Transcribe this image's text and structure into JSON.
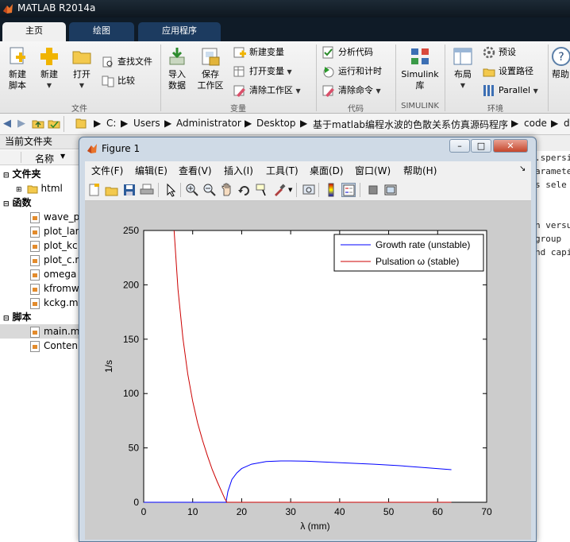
{
  "app": {
    "title": "MATLAB R2014a"
  },
  "tabs": [
    {
      "label": "主页"
    },
    {
      "label": "绘图"
    },
    {
      "label": "应用程序"
    }
  ],
  "ribbon": {
    "new_script": "新建\n脚本",
    "new": "新建",
    "open": "打开",
    "find_files": "查找文件",
    "compare": "比较",
    "import_data": "导入\n数据",
    "save_workspace": "保存\n工作区",
    "new_variable": "新建变量",
    "open_variable": "打开变量",
    "clear_workspace": "清除工作区",
    "analyze_code": "分析代码",
    "run_and_time": "运行和计时",
    "clear_commands": "清除命令",
    "simulink_library": "Simulink\n库",
    "layout": "布局",
    "preferences": "预设",
    "set_path": "设置路径",
    "parallel": "Parallel",
    "help": "帮助",
    "groups": {
      "file": "文件",
      "variable": "变量",
      "code": "代码",
      "simulink": "SIMULINK",
      "environment": "环境"
    }
  },
  "address": {
    "segments": [
      "C:",
      "Users",
      "Administrator",
      "Desktop",
      "基于matlab编程水波的色散关系仿真源码程序",
      "code",
      "d"
    ]
  },
  "current_folder": {
    "title": "当前文件夹",
    "column_name": "名称",
    "sections": [
      {
        "label": "文件夹",
        "items": [
          "html"
        ]
      },
      {
        "label": "函数",
        "items": [
          "wave_p",
          "plot_lar",
          "plot_kc",
          "plot_c.n",
          "omega",
          "kfromw",
          "kckg.m"
        ]
      },
      {
        "label": "脚本",
        "items": [
          "main.m",
          "Conten"
        ]
      }
    ]
  },
  "code_panel": {
    "lines": [
      ".spersi",
      "aramete",
      "s sele",
      "",
      "",
      "n versu",
      "group",
      "nd capi"
    ]
  },
  "figure": {
    "title": "Figure 1",
    "menu": [
      "文件(F)",
      "编辑(E)",
      "查看(V)",
      "插入(I)",
      "工具(T)",
      "桌面(D)",
      "窗口(W)",
      "帮助(H)"
    ],
    "toolbar": [
      "new-figure-icon",
      "open-file-icon",
      "save-icon",
      "print-icon",
      "pointer-icon",
      "zoom-in-icon",
      "zoom-out-icon",
      "pan-icon",
      "rotate-3d-icon",
      "data-cursor-icon",
      "brush-icon",
      "link-plot-icon",
      "colorbar-icon",
      "legend-icon",
      "hide-plot-tools-icon",
      "show-plot-tools-icon"
    ]
  },
  "chart_data": {
    "type": "line",
    "title": "",
    "xlabel": "λ (mm)",
    "ylabel": "1/s",
    "xlim": [
      0,
      70
    ],
    "ylim": [
      0,
      250
    ],
    "xticks": [
      0,
      10,
      20,
      30,
      40,
      50,
      60,
      70
    ],
    "yticks": [
      0,
      50,
      100,
      150,
      200,
      250
    ],
    "grid": false,
    "legend_position": "top-right",
    "series": [
      {
        "name": "Growth rate (unstable)",
        "color": "#0000ff",
        "x": [
          0,
          16.8,
          17.2,
          18,
          19,
          20,
          22,
          25,
          28,
          30,
          33,
          37,
          42,
          47,
          52,
          57,
          62.8
        ],
        "y": [
          0,
          0,
          10,
          21,
          27,
          31,
          35,
          37.5,
          38,
          38,
          37.8,
          37,
          36,
          35,
          33.7,
          32,
          30
        ]
      },
      {
        "name": "Pulsation ω (stable)",
        "color": "#cc0000",
        "x": [
          6.2,
          7,
          8,
          9,
          10,
          11,
          12,
          13,
          14,
          15,
          16,
          16.6,
          17,
          17.5,
          20,
          30,
          40,
          50,
          62.8
        ],
        "y": [
          250,
          196,
          151,
          118,
          93,
          73,
          57,
          43,
          30,
          19,
          9,
          3,
          0,
          0,
          0,
          0,
          0,
          0,
          0
        ]
      }
    ]
  }
}
